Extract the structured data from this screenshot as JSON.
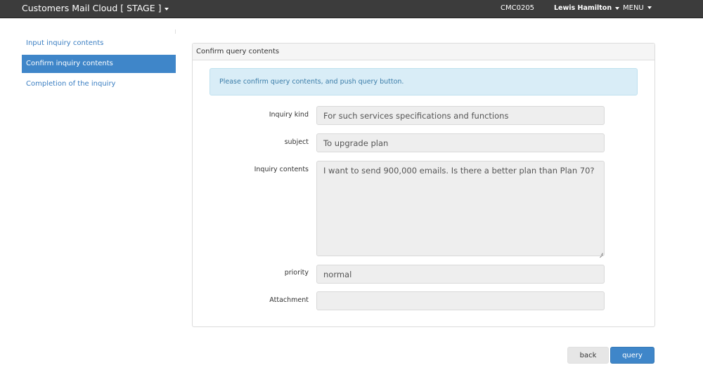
{
  "header": {
    "app_title": "Customers Mail Cloud [ STAGE ]",
    "code": "CMC0205",
    "user": "Lewis Hamilton",
    "menu": "MENU"
  },
  "sidebar": {
    "items": [
      {
        "label": "Input inquiry contents",
        "active": false
      },
      {
        "label": "Confirm inquiry contents",
        "active": true
      },
      {
        "label": "Completion of the inquiry",
        "active": false
      }
    ]
  },
  "panel": {
    "title": "Confirm query contents",
    "alert": "Please confirm query contents, and push query button.",
    "fields": {
      "inquiry_kind": {
        "label": "Inquiry kind",
        "value": "For such services specifications and functions"
      },
      "subject": {
        "label": "subject",
        "value": "To upgrade plan"
      },
      "contents": {
        "label": "Inquiry contents",
        "value": "I want to send 900,000 emails. Is there a better plan than Plan 70?"
      },
      "priority": {
        "label": "priority",
        "value": "normal"
      },
      "attachment": {
        "label": "Attachment",
        "value": ""
      }
    }
  },
  "actions": {
    "back_label": "back",
    "query_label": "query"
  },
  "colors": {
    "navbar": "#3c3c3c",
    "accent": "#3f86c9",
    "alert_bg": "#d9edf7",
    "field_bg": "#eeeeee"
  }
}
